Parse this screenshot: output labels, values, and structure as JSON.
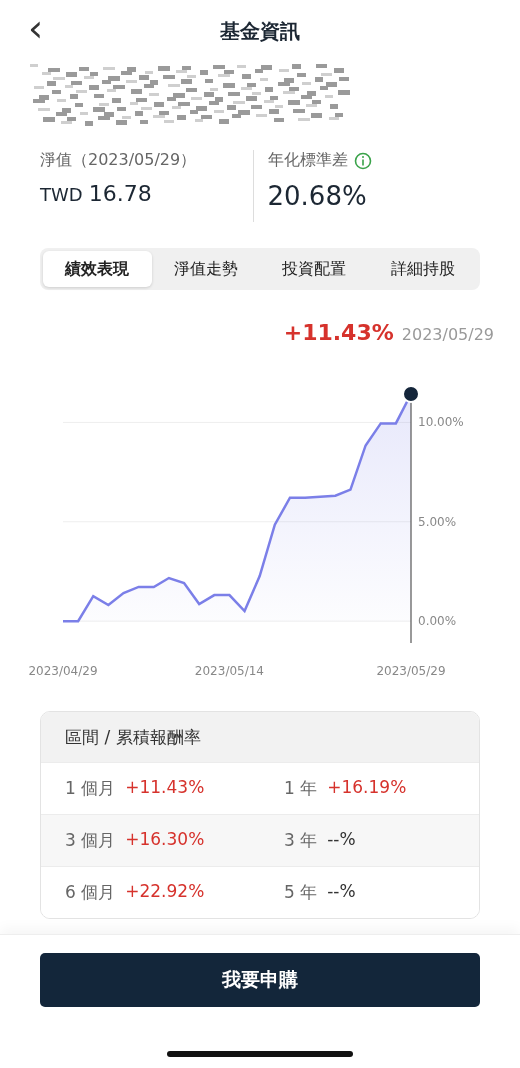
{
  "header": {
    "back": "‹",
    "title": "基金資訊"
  },
  "stats": [
    {
      "label": "淨值（2023/05/29）",
      "prefix": "TWD",
      "value": "16.78"
    },
    {
      "label": "年化標準差",
      "value": "20.68%",
      "info": true
    }
  ],
  "tabs": [
    {
      "label": "績效表現",
      "selected": true
    },
    {
      "label": "淨值走勢",
      "selected": false
    },
    {
      "label": "投資配置",
      "selected": false
    },
    {
      "label": "詳細持股",
      "selected": false
    }
  ],
  "chart_head": {
    "change": "+11.43%",
    "date": "2023/05/29"
  },
  "chart_data": {
    "type": "area",
    "categories": [
      "2023/04/29",
      null,
      null,
      null,
      null,
      null,
      null,
      null,
      null,
      null,
      null,
      "2023/05/14",
      null,
      null,
      null,
      null,
      null,
      null,
      null,
      null,
      null,
      null,
      null,
      "2023/05/29"
    ],
    "series": [
      {
        "color": "#7b7fe8",
        "values": [
          0,
          0,
          1.26,
          0.81,
          1.41,
          1.72,
          1.72,
          2.17,
          1.92,
          0.86,
          1.31,
          1.31,
          0.51,
          2.27,
          4.85,
          6.21,
          6.21,
          6.26,
          6.31,
          6.62,
          8.84,
          9.95,
          9.95,
          11.43
        ]
      }
    ],
    "ylim": [
      -1.1,
      11.43
    ],
    "grid": true,
    "yticks": [
      {
        "value": 0,
        "label": "0.00%"
      },
      {
        "value": 5,
        "label": "5.00%"
      },
      {
        "value": 10,
        "label": "10.00%"
      }
    ]
  },
  "returns": {
    "title": "區間 / 累積報酬率",
    "rows": [
      [
        {
          "period": "1 個月",
          "value": "+11.43%",
          "positive": true
        },
        {
          "period": "1 年",
          "value": "+16.19%",
          "positive": true
        }
      ],
      [
        {
          "period": "3 個月",
          "value": "+16.30%",
          "positive": true
        },
        {
          "period": "3 年",
          "value": "--%",
          "positive": false
        }
      ],
      [
        {
          "period": "6 個月",
          "value": "+22.92%",
          "positive": true
        },
        {
          "period": "5 年",
          "value": "--%",
          "positive": false
        }
      ]
    ]
  },
  "cta": "我要申購"
}
